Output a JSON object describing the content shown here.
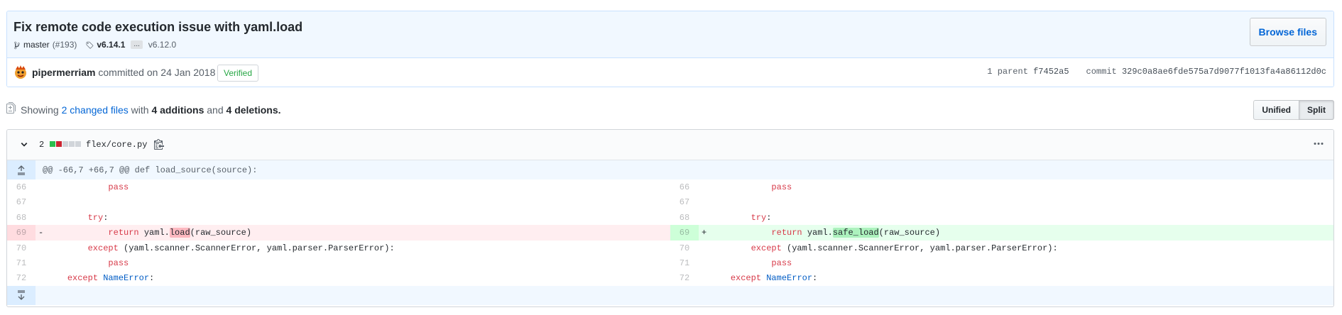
{
  "commit": {
    "title": "Fix remote code execution issue with yaml.load",
    "branch": "master",
    "pr": "(#193)",
    "tag_from": "v6.14.1",
    "ellipsis": "...",
    "tag_to": "v6.12.0",
    "browse_label": "Browse files",
    "author": "pipermerriam",
    "committed_text": "committed on 24 Jan 2018",
    "verified_label": "Verified",
    "parent_label": "1 parent",
    "parent_sha": "f7452a5",
    "commit_label": "commit",
    "commit_sha": "329c0a8ae6fde575a7d9077f1013fa4a86112d0c"
  },
  "toc": {
    "showing": "Showing",
    "changed_files": "2 changed files",
    "with": "with",
    "additions": "4 additions",
    "and": "and",
    "deletions": "4 deletions.",
    "unified_label": "Unified",
    "split_label": "Split"
  },
  "file": {
    "count": "2",
    "path": "flex/core.py",
    "hunk_header": "@@ -66,7 +66,7 @@ def load_source(source):",
    "colors": {
      "add": "#2cbe4e",
      "del": "#cb2431",
      "neutral": "#d1d5da"
    }
  },
  "diff_lines": [
    {
      "l": "66",
      "r": "66",
      "text": "            pass"
    },
    {
      "l": "67",
      "r": "67",
      "text": ""
    },
    {
      "l": "68",
      "r": "68",
      "text": "        try:"
    },
    {
      "l": "69",
      "r": "69",
      "del_prefix": "            return yaml.",
      "del_hl": "load",
      "del_suffix": "(raw_source)",
      "add_prefix": "            return yaml.",
      "add_hl": "safe_load",
      "add_suffix": "(raw_source)"
    },
    {
      "l": "70",
      "r": "70",
      "text": "        except (yaml.scanner.ScannerError, yaml.parser.ParserError):"
    },
    {
      "l": "71",
      "r": "71",
      "text": "            pass"
    },
    {
      "l": "72",
      "r": "72",
      "text": "    except NameError:"
    }
  ]
}
